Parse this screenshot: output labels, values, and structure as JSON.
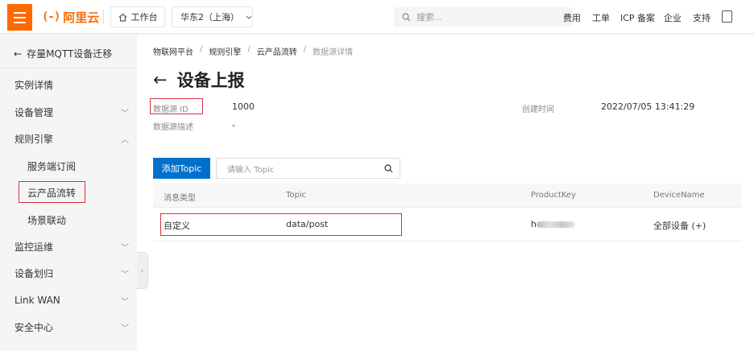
{
  "header": {
    "logo_mark": "(-)",
    "logo_text": "阿里云",
    "workbench": "工作台",
    "region": "华东2（上海）",
    "search_placeholder": "搜索...",
    "nav": [
      "费用",
      "工单",
      "ICP 备案",
      "企业",
      "支持"
    ]
  },
  "sidebar": {
    "back_label": "存量MQTT设备迁移",
    "items": [
      {
        "label": "实例详情",
        "chevron": ""
      },
      {
        "label": "设备管理",
        "chevron": "﹀"
      },
      {
        "label": "规则引擎",
        "chevron": "︿"
      },
      {
        "label": "服务端订阅",
        "chevron": ""
      },
      {
        "label": "云产品流转",
        "chevron": ""
      },
      {
        "label": "场景联动",
        "chevron": ""
      },
      {
        "label": "监控运维",
        "chevron": "﹀"
      },
      {
        "label": "设备划归",
        "chevron": "﹀"
      },
      {
        "label": "Link WAN",
        "chevron": "﹀"
      },
      {
        "label": "安全中心",
        "chevron": "﹀"
      }
    ],
    "collapse_glyph": "‹"
  },
  "breadcrumb": [
    "物联网平台",
    "规则引擎",
    "云产品流转",
    "数据源详情"
  ],
  "breadcrumb_sep": "/",
  "page": {
    "back_glyph": "←",
    "title": "设备上报"
  },
  "meta": {
    "source_id_label": "数据源 ID",
    "source_id_value": "1000",
    "desc_label": "数据源描述",
    "desc_value": "-",
    "created_label": "创建时间",
    "created_value": "2022/07/05 13:41:29"
  },
  "toolbar": {
    "add_topic_label": "添加Topic",
    "topic_placeholder": "请输入 Topic"
  },
  "table": {
    "columns": [
      "消息类型",
      "Topic",
      "ProductKey",
      "DeviceName"
    ],
    "rows": [
      {
        "type": "自定义",
        "topic": "data/post",
        "product_key_prefix": "h",
        "device_name": "全部设备 (+)"
      }
    ]
  }
}
